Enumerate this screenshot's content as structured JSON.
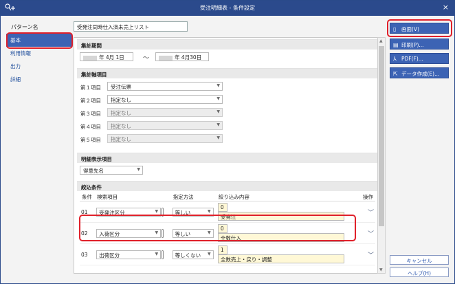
{
  "window": {
    "title": "受注明細表 - 条件設定",
    "app_icon": "key-plus-icon",
    "close_glyph": "×"
  },
  "pattern": {
    "label": "パターン名",
    "value": "受発注同時仕入済未売上リスト"
  },
  "sidebar": {
    "items": [
      {
        "label": "基本",
        "active": true
      },
      {
        "label": "利用情報"
      },
      {
        "label": "出力"
      },
      {
        "label": "詳細"
      }
    ]
  },
  "period": {
    "title": "集計期間",
    "start_date": "年  4月  1日",
    "end_date": "年  4月30日",
    "separator": "～"
  },
  "axis": {
    "title": "集計軸項目",
    "rows": [
      {
        "label": "第１項目",
        "value": "受注伝票",
        "enabled": true
      },
      {
        "label": "第２項目",
        "value": "指定なし",
        "enabled": true
      },
      {
        "label": "第３項目",
        "value": "指定なし",
        "enabled": false
      },
      {
        "label": "第４項目",
        "value": "指定なし",
        "enabled": false
      },
      {
        "label": "第５項目",
        "value": "指定なし",
        "enabled": false
      }
    ]
  },
  "detail": {
    "title": "明細表示項目",
    "value": "得意先名"
  },
  "filter": {
    "title": "絞込条件",
    "headers": [
      "条件",
      "検索項目",
      "指定方法",
      "絞り込み内容",
      "操作"
    ],
    "rows": [
      {
        "no": "01",
        "item": "受発注区分",
        "method": "等しい",
        "code": "0",
        "content": "受発注"
      },
      {
        "no": "02",
        "item": "入荷区分",
        "method": "等しい",
        "code": "0",
        "content": "全数仕入"
      },
      {
        "no": "03",
        "item": "出荷区分",
        "method": "等しくない",
        "code": "1",
        "content": "全数売上・戻り・調整"
      }
    ]
  },
  "buttons": {
    "screen": "画面(V)",
    "print": "印刷(P)...",
    "pdf": "PDF(F)...",
    "data": "データ作成(E)...",
    "cancel": "キャンセル",
    "help": "ヘルプ(H)"
  },
  "colors": {
    "titlebar": "#2b4a8c",
    "accent": "#3c63b4",
    "highlight": "#e0202a",
    "input_yellow": "#fff8d6"
  }
}
